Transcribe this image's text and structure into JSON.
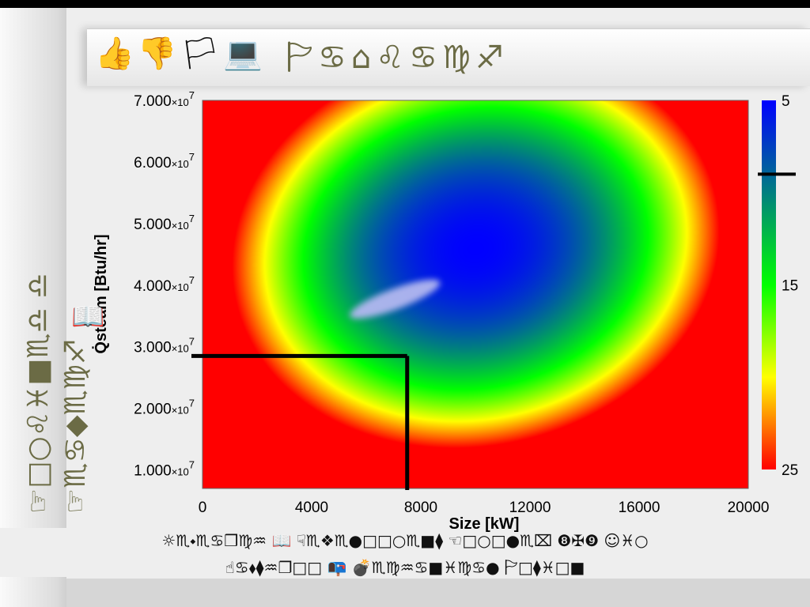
{
  "slide": {
    "title_icons": "👍👎🏳💻",
    "title_text": "🏱♋⌂♌♋♍♐",
    "vertical_title_line1": "☞□○♌♓■♏♎ ♎",
    "vertical_title_line2": "☞♏♋◆♏♍♐",
    "footer_line1": "☼♏⬩♏♋❒♍♒ 📖 ☟♏❖♏●□□○♏■⧫ ☜□○□●♏⌧ ❽✠❾ ☺♓○",
    "footer_line2": "☝♋⬧⧫♒❐□□ 📭 💣♏♍♒♋■♓♍♋● 🏱□⧫♓□■"
  },
  "chart_data": {
    "type": "heatmap",
    "xlabel": "Size  [kW]",
    "ylabel": "Q̇steam [Btu/hr]",
    "xlim": [
      0,
      20000
    ],
    "ylim": [
      7000000,
      70000000
    ],
    "x_ticks": [
      "0",
      "4000",
      "8000",
      "12000",
      "16000",
      "20000"
    ],
    "x_tick_values": [
      0,
      4000,
      8000,
      12000,
      16000,
      20000
    ],
    "y_ticks": [
      {
        "value": 10000000,
        "mant": "1.000×10",
        "exp": "7"
      },
      {
        "value": 20000000,
        "mant": "2.000×10",
        "exp": "7"
      },
      {
        "value": 30000000,
        "mant": "3.000×10",
        "exp": "7"
      },
      {
        "value": 40000000,
        "mant": "4.000×10",
        "exp": "7"
      },
      {
        "value": 50000000,
        "mant": "5.000×10",
        "exp": "7"
      },
      {
        "value": 60000000,
        "mant": "6.000×10",
        "exp": "7"
      },
      {
        "value": 70000000,
        "mant": "7.000×10",
        "exp": "7"
      }
    ],
    "colorbar": {
      "min": 5,
      "max": 25,
      "labels": [
        "5",
        "15",
        "25"
      ],
      "label_values": [
        5,
        15,
        25
      ],
      "colors": [
        "#0000ff",
        "#00ff00",
        "#ffff00",
        "#ff0000"
      ],
      "marker_value": 9
    },
    "field_model": {
      "minimum_value": 5,
      "minimum_at": {
        "x": 10000,
        "y": 46000000
      },
      "contour_25_extent": {
        "x_halfwidth": 9000,
        "y_halfwidth": 32000000
      },
      "tilt_deg": -12
    },
    "infeasible_region": {
      "x": [
        5400,
        8700
      ],
      "y": [
        35000000,
        40500000
      ],
      "color": "#b3b8f0"
    },
    "crosshair": {
      "x": 7500,
      "y": 28500000
    }
  }
}
